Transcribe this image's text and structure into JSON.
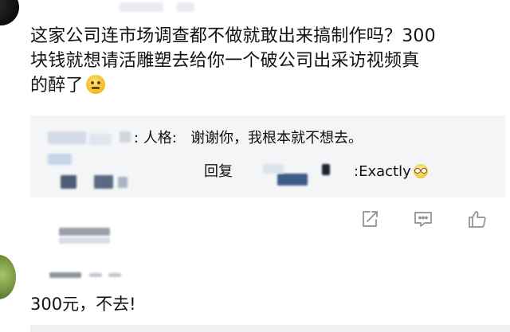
{
  "post": {
    "text_line_1": "这家公司连市场调查都不做就敢出来搞制作吗？300",
    "text_line_2": "块钱就想请活雕塑去给你一个破公司出采访视频真",
    "text_line_3": "的醉了",
    "text_emoji": "dizzy-face-emoji-icon"
  },
  "reply_box": {
    "line1_prefix": ":",
    "line1_name": "人格:",
    "line1_text": "谢谢你，我根本就不想去。",
    "line2_reply": "回复",
    "line2_text": ":Exactly",
    "line2_emoji": "glasses-emoji-icon"
  },
  "actions": {
    "share_icon": "share-icon",
    "comment_icon": "comment-icon",
    "like_icon": "like-icon"
  },
  "comment": {
    "text": "300元，不去!"
  }
}
